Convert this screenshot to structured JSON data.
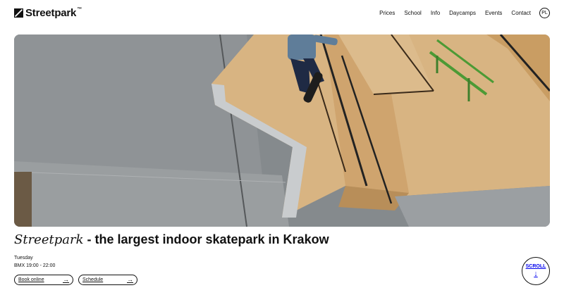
{
  "brand": {
    "name": "Streetpark",
    "tm": "™",
    "logo_icon": "streetpark-logo-icon"
  },
  "nav": {
    "items": [
      {
        "label": "Prices"
      },
      {
        "label": "School"
      },
      {
        "label": "Info"
      },
      {
        "label": "Daycamps"
      },
      {
        "label": "Events"
      },
      {
        "label": "Contact"
      }
    ],
    "language": "PL"
  },
  "hero": {
    "media": "skateboarder-indoor-ramp-video"
  },
  "headline": {
    "brand": "Streetpark",
    "rest": " - the largest indoor skatepark in Krakow"
  },
  "schedule": {
    "day": "Tuesday",
    "hours": "BMX 19:00 - 22:00"
  },
  "actions": {
    "book_label": "Book online",
    "schedule_label": "Schedule",
    "arrow_icon": "arrow-right-icon"
  },
  "scroll": {
    "label": "SCROLL",
    "icon": "arrow-down-icon"
  }
}
